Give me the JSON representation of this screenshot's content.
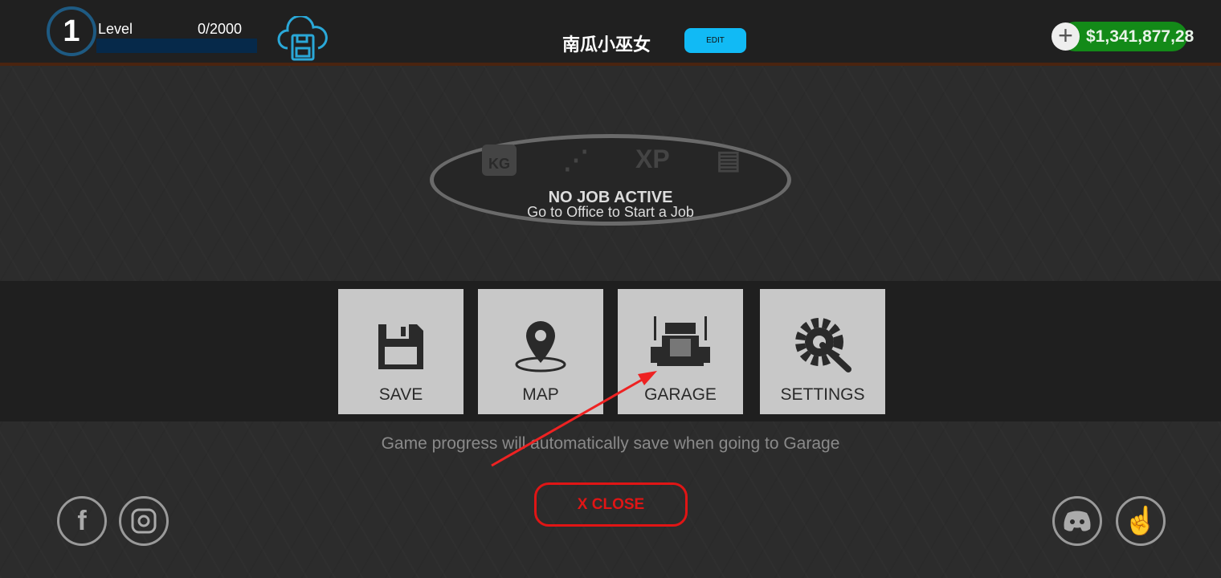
{
  "header": {
    "level": "1",
    "level_label": "Level",
    "xp": "0/2000",
    "xp_progress": 0,
    "player_name": "南瓜小巫女",
    "edit_label": "EDIT",
    "money": "$1,341,877,28",
    "cloud_icon": "cloud-save-icon"
  },
  "job": {
    "title": "NO JOB ACTIVE",
    "subtitle": "Go to Office to Start a Job",
    "icons": [
      "weight-icon",
      "route-icon",
      "xp-icon",
      "money-icon"
    ],
    "xp_text": "XP",
    "kg_text": "KG"
  },
  "menu": [
    {
      "label": "SAVE",
      "icon": "floppy-icon"
    },
    {
      "label": "MAP",
      "icon": "map-pin-icon"
    },
    {
      "label": "GARAGE",
      "icon": "truck-icon"
    },
    {
      "label": "SETTINGS",
      "icon": "gear-wrench-icon"
    }
  ],
  "hint": "Game progress will automatically save when going to Garage",
  "close_label": "X  CLOSE",
  "social": [
    "facebook-icon",
    "instagram-icon",
    "discord-icon",
    "tap-icon"
  ],
  "colors": {
    "accent": "#11baf5",
    "money": "#138a18",
    "close": "#e01515",
    "annotation_arrow": "#ee2222"
  }
}
